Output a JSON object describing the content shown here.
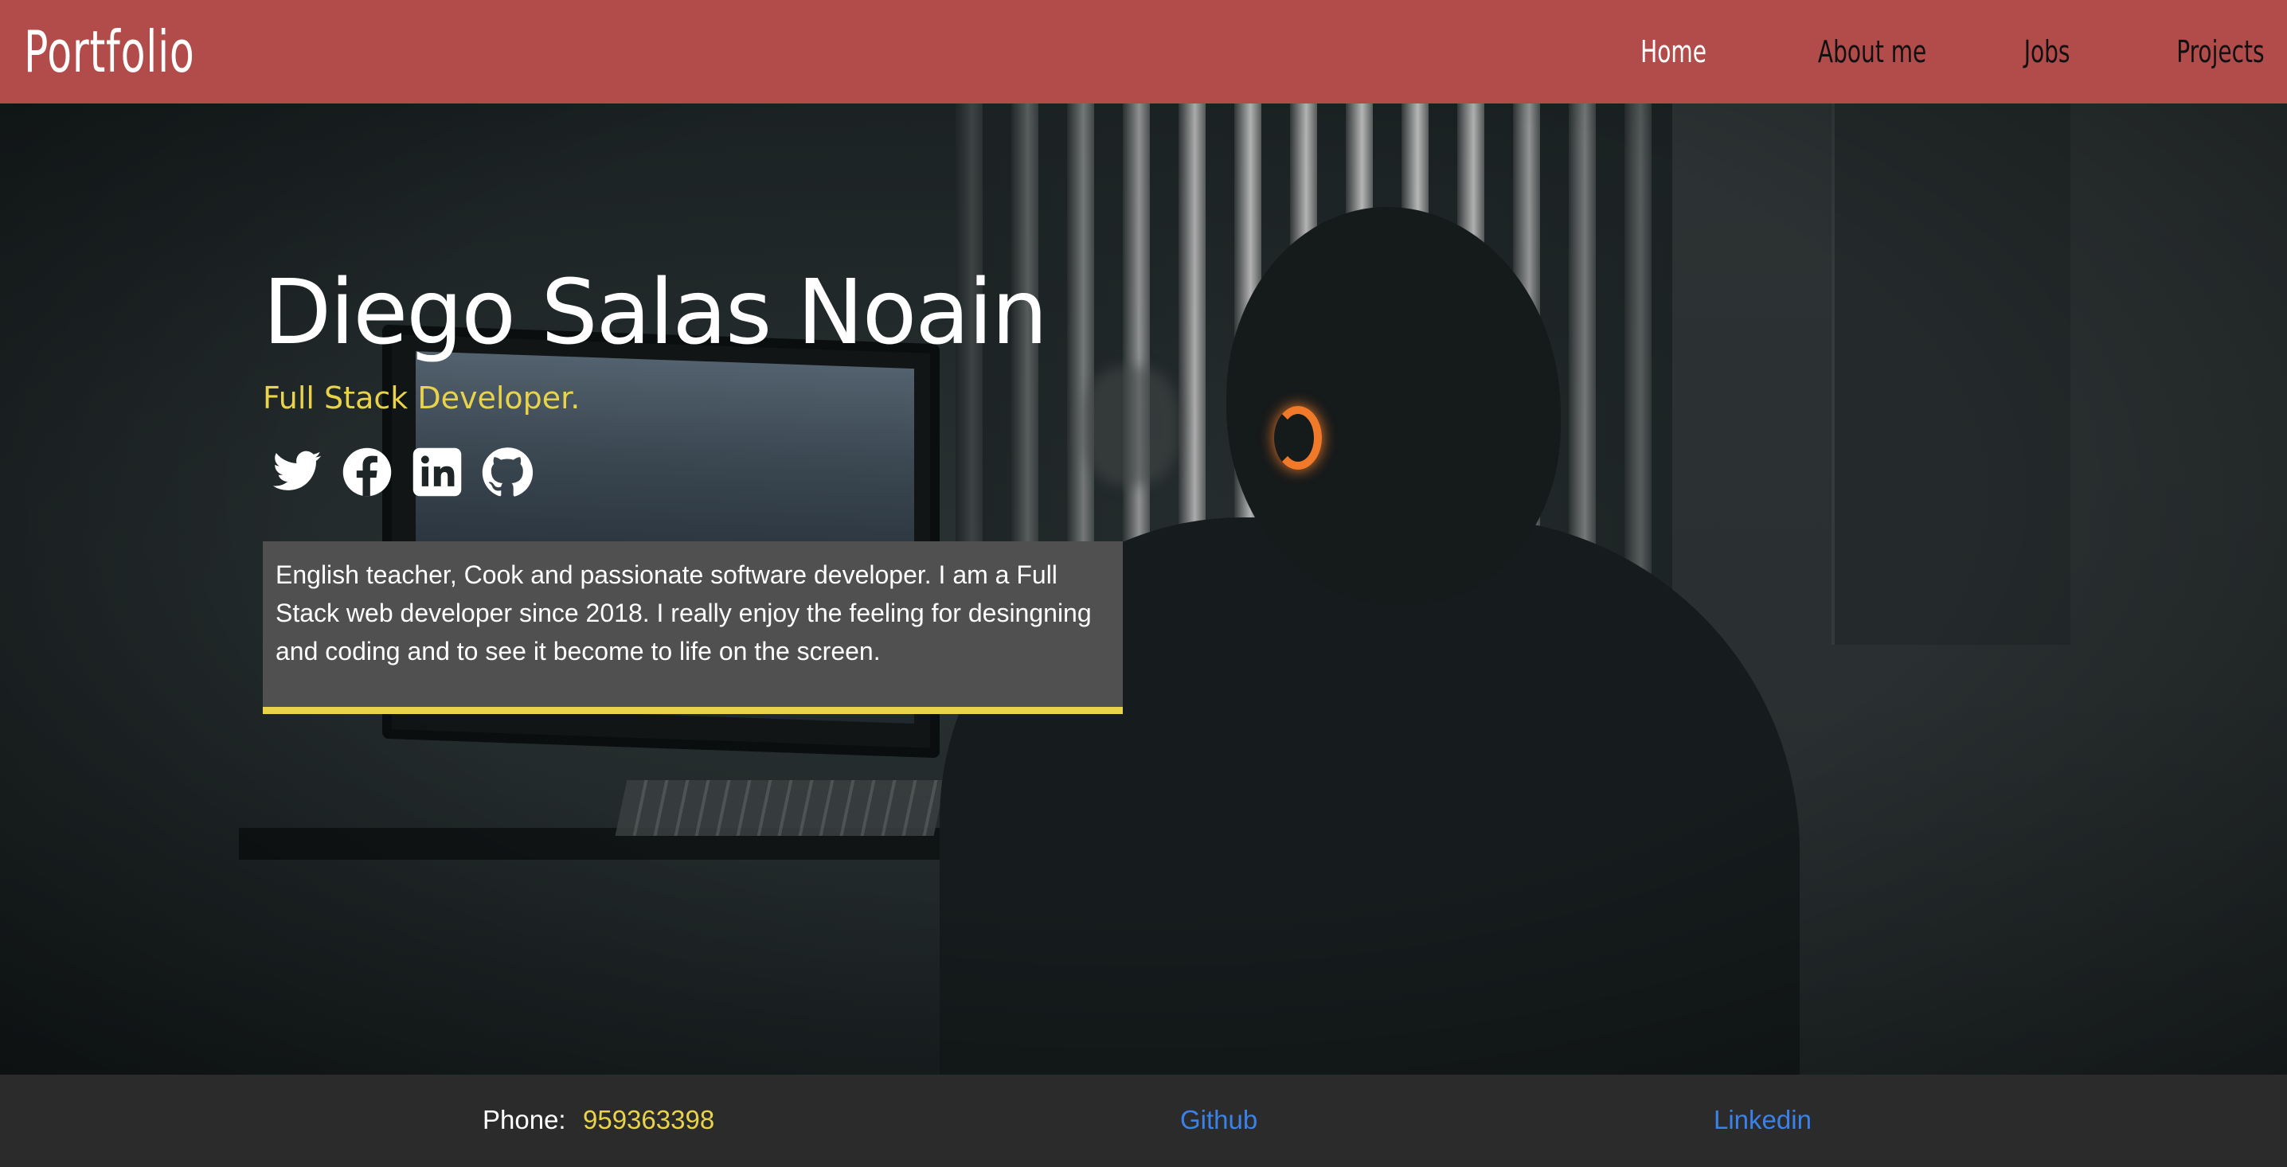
{
  "navbar": {
    "brand": "Portfolio",
    "links": [
      {
        "label": "Home",
        "active": true
      },
      {
        "label": "About me",
        "active": false
      },
      {
        "label": "Jobs",
        "active": false
      },
      {
        "label": "Projects",
        "active": false
      }
    ]
  },
  "hero": {
    "name": "Diego Salas Noain",
    "subtitle": "Full Stack Developer.",
    "socials": [
      {
        "icon": "twitter-icon"
      },
      {
        "icon": "facebook-icon"
      },
      {
        "icon": "linkedin-icon"
      },
      {
        "icon": "github-icon"
      }
    ],
    "about": "English teacher, Cook and passionate software developer. I am a Full Stack web developer since 2018. I really enjoy the feeling for desingning and coding and to see it become to life on the screen."
  },
  "footer": {
    "phone_label": "Phone:",
    "phone_value": "959363398",
    "github_label": "Github",
    "linkedin_label": "Linkedin"
  },
  "colors": {
    "navbar_bg": "#b24c4b",
    "accent_yellow": "#e8d34a",
    "link_blue": "#3b82e8",
    "footer_bg": "#2b2b2b",
    "about_bg": "#505050"
  }
}
